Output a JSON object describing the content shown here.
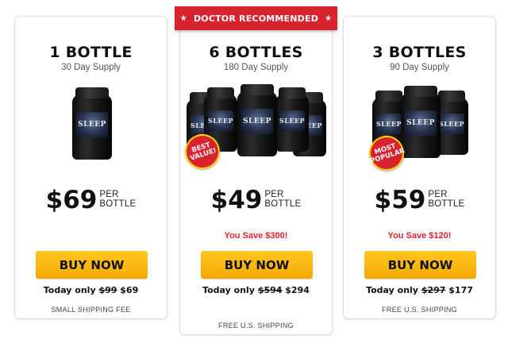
{
  "banner": {
    "label": "DOCTOR RECOMMENDED",
    "star": "★"
  },
  "product_label": "SLEEP",
  "cards": [
    {
      "title": "1 BOTTLE",
      "supply": "30 Day Supply",
      "price": "$69",
      "per_line1": "PER",
      "per_line2": "BOTTLE",
      "button": "BUY NOW",
      "today_prefix": "Today only",
      "today_old": "$99",
      "today_new": "$69",
      "shipping": "SMALL SHIPPING FEE"
    },
    {
      "title": "6 BOTTLES",
      "supply": "180 Day Supply",
      "badge": "BEST VALUE!",
      "price": "$49",
      "per_line1": "PER",
      "per_line2": "BOTTLE",
      "save": "You Save $300!",
      "button": "BUY NOW",
      "today_prefix": "Today only",
      "today_old": "$594",
      "today_new": "$294",
      "shipping": "FREE U.S. SHIPPING"
    },
    {
      "title": "3 BOTTLES",
      "supply": "90 Day Supply",
      "badge": "MOST POPULAR",
      "price": "$59",
      "per_line1": "PER",
      "per_line2": "BOTTLE",
      "save": "You Save $120!",
      "button": "BUY NOW",
      "today_prefix": "Today only",
      "today_old": "$297",
      "today_new": "$177",
      "shipping": "FREE U.S. SHIPPING"
    }
  ],
  "colors": {
    "accent_red": "#d8232f",
    "button_yellow": "#f5a800",
    "badge_border": "#ffd400"
  }
}
